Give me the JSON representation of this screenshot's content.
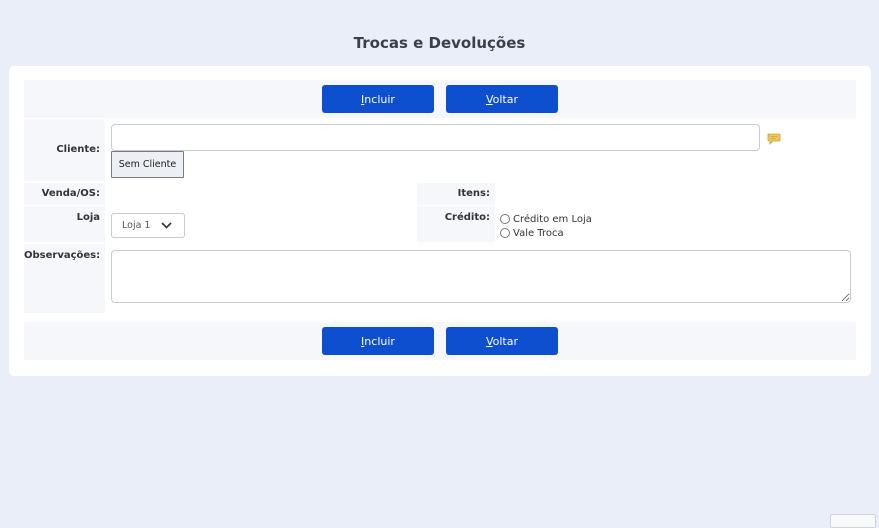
{
  "page": {
    "title": "Trocas e Devoluções"
  },
  "buttons": {
    "incluir_prefix": "I",
    "incluir_rest": "ncluir",
    "voltar_prefix": "V",
    "voltar_rest": "oltar"
  },
  "form": {
    "cliente_label": "Cliente:",
    "cliente_value": "",
    "sem_cliente_label": "Sem Cliente",
    "venda_label": "Venda/OS:",
    "itens_label": "Itens:",
    "loja_label": "Loja",
    "loja_selected": "Loja 1",
    "credito_label": "Crédito:",
    "credito_options": [
      "Crédito em Loja",
      "Vale Troca"
    ],
    "obs_label": "Observações:",
    "obs_value": ""
  },
  "colors": {
    "primary": "#0d4fcf",
    "background": "#e9eef9",
    "label_bg": "#f5f7fa",
    "chat_icon": "#f0c75e"
  },
  "icons": {
    "chat": "chat-bubble-icon",
    "chevron": "chevron-down-icon"
  }
}
